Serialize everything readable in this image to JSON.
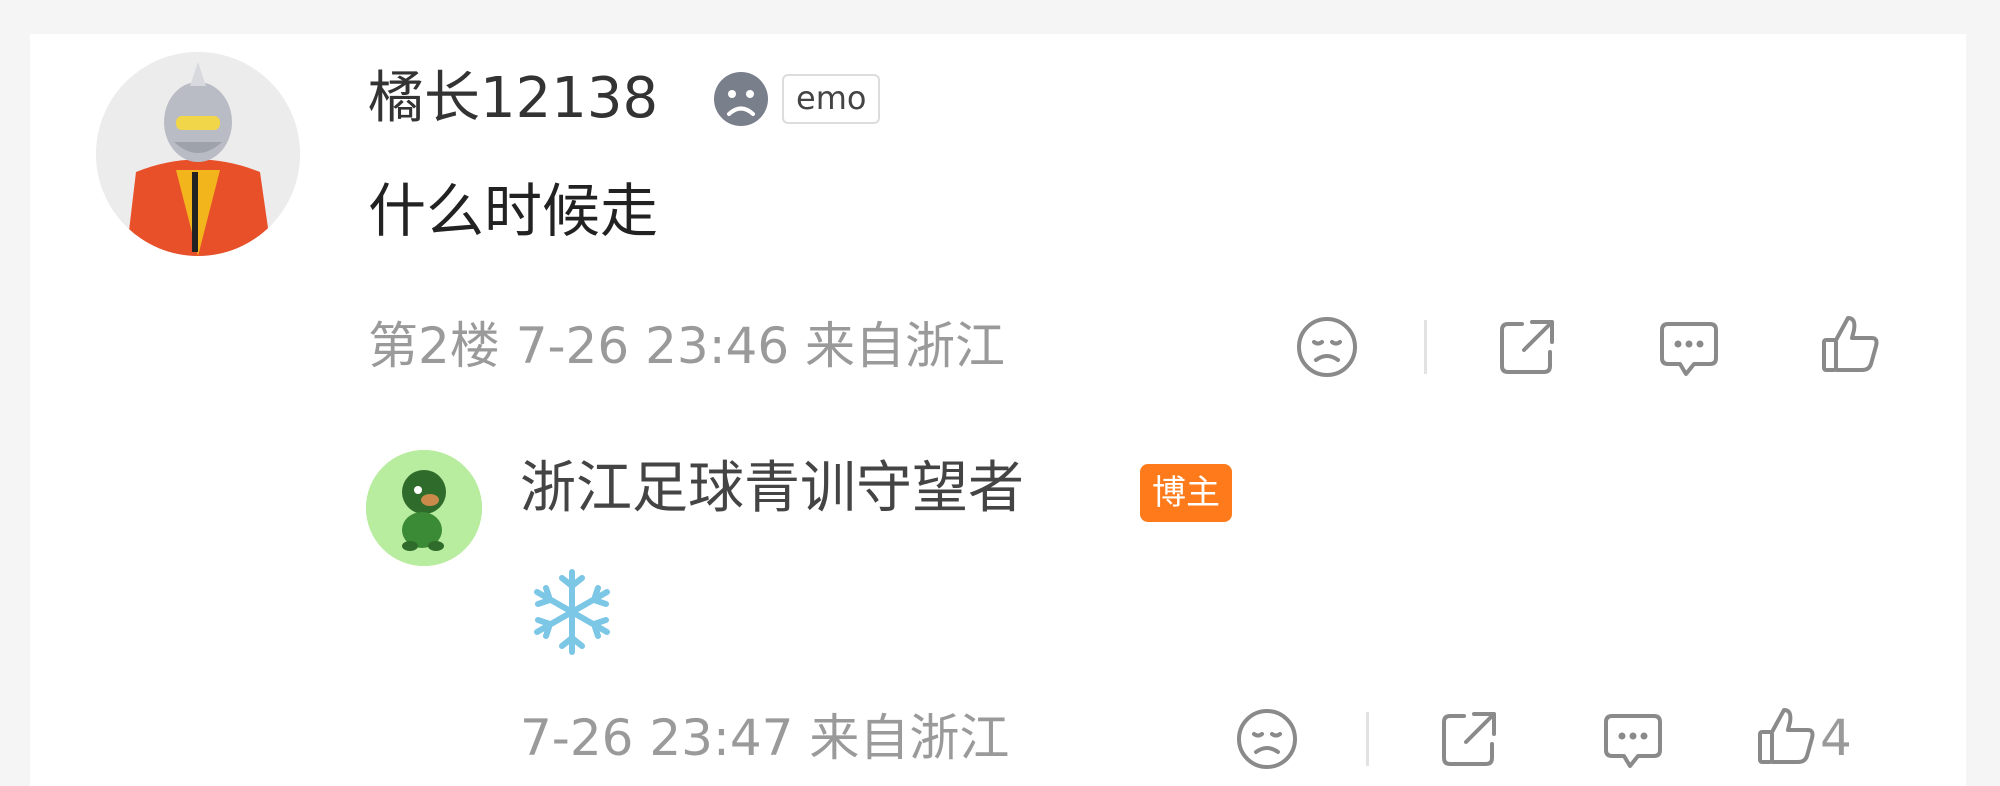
{
  "comment": {
    "author": "橘长12138",
    "emo_tag": "emo",
    "text": "什么时候走",
    "meta": "第2楼 7-26 23:46 来自浙江",
    "icons": [
      "sad-face-icon",
      "share-icon",
      "comment-icon",
      "like-icon"
    ]
  },
  "reply": {
    "author": "浙江足球青训守望者",
    "badge": "博主",
    "emoji": "❄️",
    "meta": "7-26 23:47 来自浙江",
    "like_count": "4",
    "icons": [
      "sad-face-icon",
      "share-icon",
      "comment-icon",
      "like-icon"
    ]
  },
  "colors": {
    "badge": "#ff7a1a",
    "meta_text": "#9a9a9a",
    "reply_avatar_bg": "#b8ec9e"
  }
}
